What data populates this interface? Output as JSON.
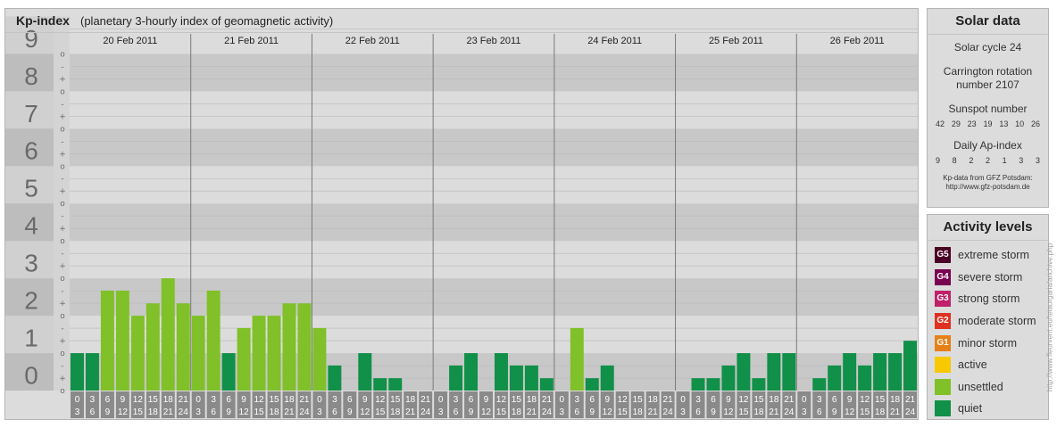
{
  "chart_data": {
    "type": "bar",
    "title": "Kp-index",
    "subtitle": "(planetary 3-hourly index of geomagnetic activity)",
    "y_ticks": [
      "0",
      "1",
      "2",
      "3",
      "4",
      "5",
      "6",
      "7",
      "8",
      "9"
    ],
    "ylim": [
      0,
      9
    ],
    "minor_marks": [
      "-",
      "o",
      "+"
    ],
    "days": [
      "20 Feb 2011",
      "21 Feb 2011",
      "22 Feb 2011",
      "23 Feb 2011",
      "24 Feb 2011",
      "25 Feb 2011",
      "26 Feb 2011"
    ],
    "interval_labels": [
      [
        "0",
        "3"
      ],
      [
        "3",
        "6"
      ],
      [
        "6",
        "9"
      ],
      [
        "9",
        "12"
      ],
      [
        "12",
        "15"
      ],
      [
        "15",
        "18"
      ],
      [
        "18",
        "21"
      ],
      [
        "21",
        "24"
      ]
    ],
    "values": [
      [
        1.0,
        1.0,
        2.67,
        2.67,
        2.0,
        2.33,
        3.0,
        2.33
      ],
      [
        2.0,
        2.67,
        1.0,
        1.67,
        2.0,
        2.0,
        2.33,
        2.33
      ],
      [
        1.67,
        0.67,
        0.0,
        1.0,
        0.33,
        0.33,
        0.0,
        0.0
      ],
      [
        0.0,
        0.67,
        1.0,
        0.0,
        1.0,
        0.67,
        0.67,
        0.33
      ],
      [
        0.0,
        1.67,
        0.33,
        0.67,
        0.0,
        0.0,
        0.0,
        0.0
      ],
      [
        0.0,
        0.33,
        0.33,
        0.67,
        1.0,
        0.33,
        1.0,
        1.0
      ],
      [
        0.0,
        0.33,
        0.67,
        1.0,
        0.67,
        1.0,
        1.0,
        1.33
      ]
    ],
    "colors": {
      "quiet": "#109048",
      "unsettled": "#80c028",
      "panel_bg": "#dcdcdc",
      "band_dark": "#c8c8c8",
      "band_light": "#dcdcdc",
      "axis_bg": "#bdbdbd",
      "axis_text": "#6a6a6a",
      "x_label_bg": "#8a8a8a"
    },
    "grid": true
  },
  "solar": {
    "title": "Solar data",
    "cycle": "Solar cycle 24",
    "carrington": [
      "Carrington rotation",
      "number 2107"
    ],
    "sunspot_label": "Sunspot number",
    "sunspots": [
      "42",
      "29",
      "23",
      "19",
      "13",
      "10",
      "26"
    ],
    "ap_label": "Daily Ap-index",
    "ap": [
      "9",
      "8",
      "2",
      "2",
      "1",
      "3",
      "3"
    ],
    "credit": [
      "Kp-data from GFZ Potsdam:",
      "http://www.gfz-potsdam.de"
    ]
  },
  "activity": {
    "title": "Activity levels",
    "levels": [
      {
        "code": "G5",
        "label": "extreme storm",
        "color": "#4a0024"
      },
      {
        "code": "G4",
        "label": "severe storm",
        "color": "#7a0050"
      },
      {
        "code": "G3",
        "label": "strong storm",
        "color": "#c0206a"
      },
      {
        "code": "G2",
        "label": "moderate storm",
        "color": "#e03020"
      },
      {
        "code": "G1",
        "label": "minor storm",
        "color": "#e88018"
      },
      {
        "code": "",
        "label": "active",
        "color": "#f8c800"
      },
      {
        "code": "",
        "label": "unsettled",
        "color": "#80c028"
      },
      {
        "code": "",
        "label": "quiet",
        "color": "#109048"
      }
    ]
  },
  "watermark": "http://www.fleurvent.eu/teiaurgaria/arichive.php"
}
